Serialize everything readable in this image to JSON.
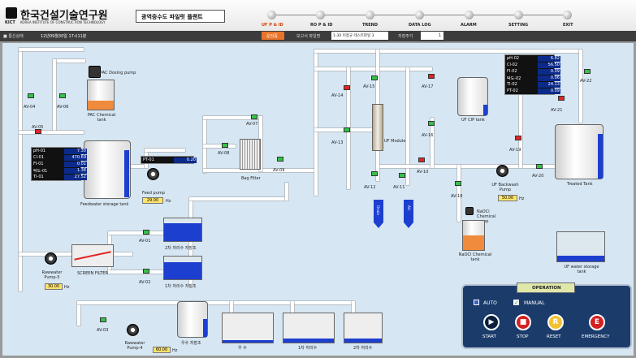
{
  "header": {
    "org_name": "한국건설기술연구원",
    "org_abbr": "KICT",
    "org_en": "KOREA INSTITUTE OF CONSTRUCTION TECHNOLOGY",
    "plant_title": "광역중수도 파일럿 플랜트"
  },
  "nav": [
    {
      "label": "UF P & ID"
    },
    {
      "label": "RO P & ID"
    },
    {
      "label": "TREND"
    },
    {
      "label": "DATA LOG"
    },
    {
      "label": "ALARM"
    },
    {
      "label": "SETTING"
    },
    {
      "label": "EXIT"
    }
  ],
  "subbar": {
    "status": "■ 통신상태",
    "datetime": "12년09월30일   17시11분",
    "run_btn": "운전중",
    "report_label": "보고서 파일명",
    "report_value": "1-30 미정규 테스트파일 3",
    "save_label": "저장주기",
    "save_value": "1"
  },
  "valves": [
    "AV-04",
    "AV-06",
    "AV-05",
    "AV-07",
    "AV-08",
    "AV-09",
    "AV-14",
    "AV-15",
    "AV-17",
    "AV-16",
    "AV-13",
    "AV-12",
    "AV-11",
    "AV-10",
    "AV-18",
    "AV-19",
    "AV-20",
    "AV-21",
    "AV-22",
    "AV-01",
    "AV-02",
    "AV-03"
  ],
  "tanks": {
    "pac_pump": "PAC Dosing pump",
    "pac_tank": "PAC Chemical tank",
    "feedwater": "Feedwater storage tank",
    "feed_pump": "Feed pump",
    "bag_filter": "Bag Filter",
    "uf_module": "UF Module",
    "uf_cip": "UF CIP tank",
    "treated": "Treated Tank",
    "uf_backwash": "UF Backwash Pump",
    "naocl_pump": "NaOCl Chemical pump",
    "naocl_tank": "NaOCl Chemical tank",
    "uf_storage": "UF water storage tank",
    "raw_pump": "Rawwater Pump-5",
    "screen": "SCREEN FILTER",
    "raw_pump2": "Rawwater Pump-4",
    "tank2a": "2차 처리수 저장조",
    "tank1a": "1차 처리수 저장조",
    "rainwater": "우수 저장조",
    "rain": "우   수",
    "first": "1차 처리수",
    "second": "2차 처리수",
    "drain": "Drain",
    "air": "Air"
  },
  "panel1": [
    {
      "k": "pH-01",
      "v": "7.30"
    },
    {
      "k": "Cl-01",
      "v": "470.69"
    },
    {
      "k": "FI-01",
      "v": "0.01"
    },
    {
      "k": "탁도-01",
      "v": "1.38"
    },
    {
      "k": "TI-01",
      "v": "27.52"
    }
  ],
  "panel2": [
    {
      "k": "pH-02",
      "v": "6.82"
    },
    {
      "k": "Cl-02",
      "v": "56.50"
    },
    {
      "k": "FI-02",
      "v": "0.09"
    },
    {
      "k": "탁도-02",
      "v": "0.06"
    },
    {
      "k": "TI-02",
      "v": "24.13"
    },
    {
      "k": "PT-02",
      "v": "0.09"
    }
  ],
  "pt01": {
    "k": "PT-01",
    "v": "0.20"
  },
  "inputs": {
    "feed_hz": "29.00",
    "feed_unit": "Hz",
    "backwash_hz": "50.00",
    "backwash_unit": "Hz",
    "raw5_hz": "30.00",
    "raw5_unit": "Hz",
    "raw4_hz": "60.00",
    "raw4_unit": "Hz"
  },
  "operation": {
    "title": "OPERATION",
    "auto": "AUTO",
    "manual": "MANUAL",
    "start": "START",
    "stop": "STOP",
    "reset": "RESET",
    "emergency": "EMERGENCY"
  }
}
